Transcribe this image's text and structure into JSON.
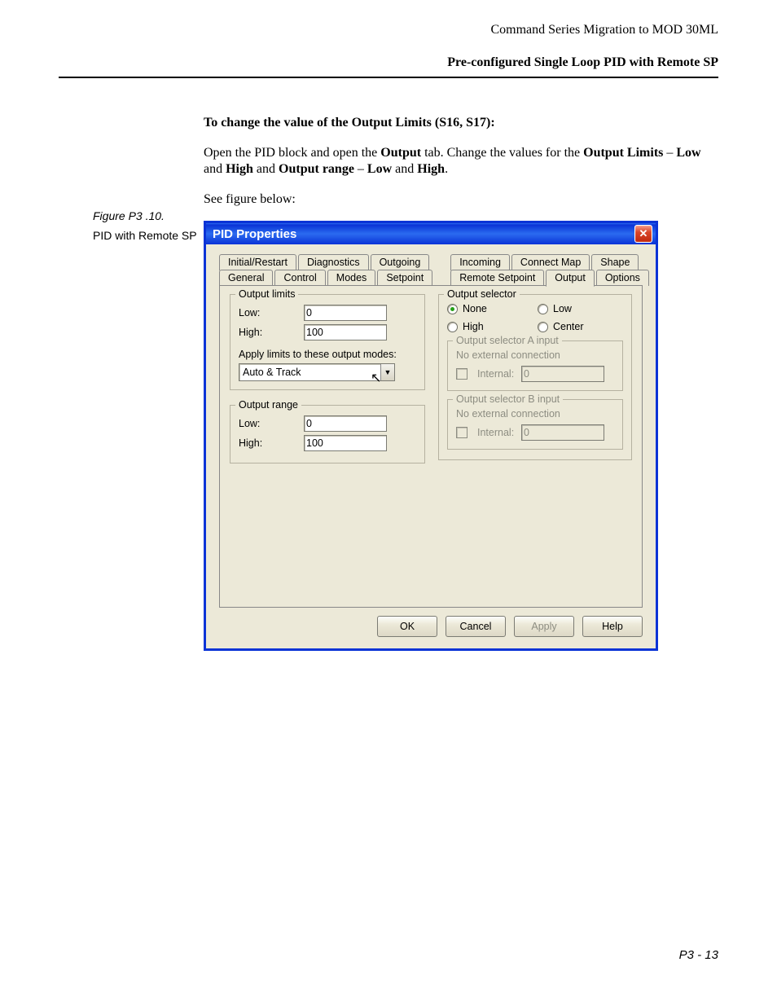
{
  "doc": {
    "header1": "Command Series Migration to MOD 30ML",
    "header2": "Pre-configured Single Loop PID with Remote SP",
    "heading": "To change the value of the Output Limits (S16, S17):",
    "para_parts": {
      "p1a": "Open the PID block and open the ",
      "p1b": "Output",
      "p1c": " tab. Change the values for the ",
      "p1d": "Output Limits",
      "p1e": " – ",
      "p1f": "Low",
      "p1g": " and ",
      "p1h": "High",
      "p1i": " and ",
      "p1j": "Output range",
      "p1k": " – ",
      "p1l": "Low",
      "p1m": " and ",
      "p1n": "High",
      "p1o": "."
    },
    "see_below": "See figure below:",
    "fig_num": "Figure P3 .10.",
    "fig_title": "PID with Remote SP",
    "pagenum": "P3 - 13"
  },
  "dlg": {
    "title": "PID Properties",
    "close_glyph": "✕",
    "tabs_row1": [
      "Initial/Restart",
      "Diagnostics",
      "Outgoing"
    ],
    "tabs_row1b": [
      "Incoming",
      "Connect Map",
      "Shape"
    ],
    "tabs_row2": [
      "General",
      "Control",
      "Modes",
      "Setpoint"
    ],
    "tabs_row2b": [
      "Remote Setpoint",
      "Output",
      "Options"
    ],
    "active_tab": "Output",
    "limits": {
      "legend": "Output limits",
      "low_label": "Low:",
      "low_value": "0",
      "high_label": "High:",
      "high_value": "100",
      "apply_label": "Apply limits to these output modes:",
      "apply_value": "Auto & Track",
      "combo_arrow": "▼"
    },
    "range": {
      "legend": "Output range",
      "low_label": "Low:",
      "low_value": "0",
      "high_label": "High:",
      "high_value": "100"
    },
    "selector": {
      "legend": "Output selector",
      "opts": [
        "None",
        "Low",
        "High",
        "Center"
      ],
      "selected": "None",
      "a_legend": "Output selector A input",
      "b_legend": "Output selector B input",
      "noext": "No external connection",
      "internal_label": "Internal:",
      "internal_value": "0"
    },
    "btns": {
      "ok": "OK",
      "cancel": "Cancel",
      "apply": "Apply",
      "help": "Help"
    }
  }
}
